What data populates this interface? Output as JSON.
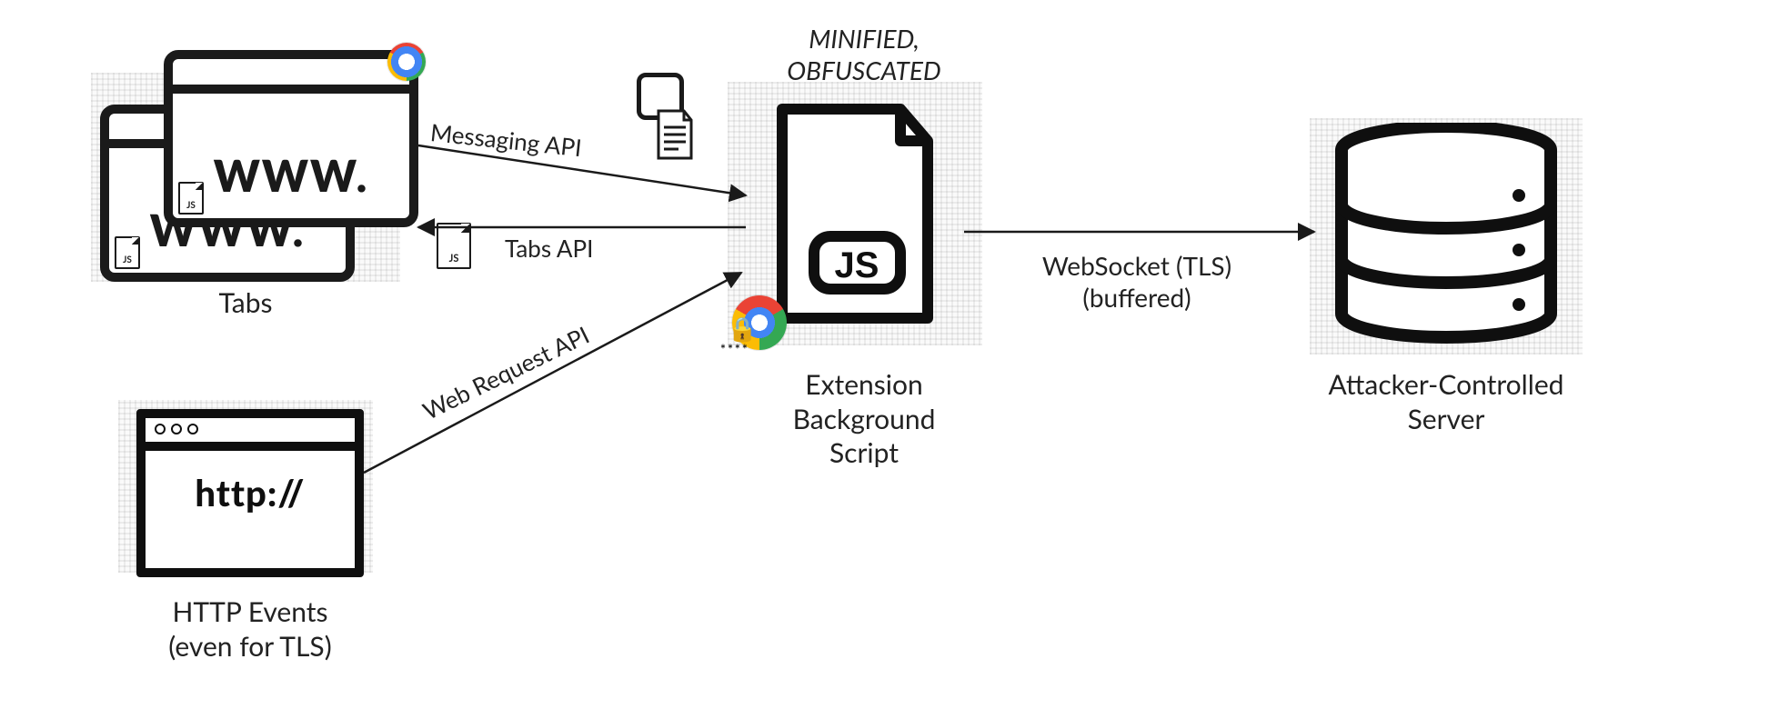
{
  "nodes": {
    "tabs": {
      "label": "Tabs",
      "window_text": "WWW."
    },
    "http_events": {
      "label": "HTTP Events\n(even for TLS)",
      "window_text": "http://"
    },
    "extension": {
      "annotation": "MINIFIED,\nOBFUSCATED",
      "label": "Extension\nBackground\nScript",
      "badge": "JS"
    },
    "server": {
      "label": "Attacker-Controlled\nServer"
    }
  },
  "edges": {
    "messaging": {
      "label": "Messaging API"
    },
    "tabs_api": {
      "label": "Tabs API"
    },
    "webrequest": {
      "label": "Web Request API"
    },
    "websocket": {
      "label": "WebSocket (TLS)\n(buffered)"
    }
  },
  "decor": {
    "mini_js_label": "JS",
    "lock_stars": "****"
  }
}
